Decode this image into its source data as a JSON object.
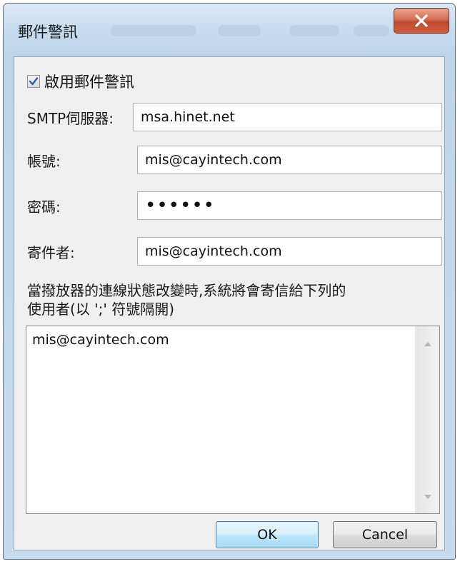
{
  "window": {
    "title": "郵件警訊"
  },
  "form": {
    "enable_label": "啟用郵件警訊",
    "enable_checked": true,
    "smtp_label": "SMTP伺服器:",
    "smtp_value": "msa.hinet.net",
    "account_label": "帳號:",
    "account_value": "mis@cayintech.com",
    "password_label": "密碼:",
    "password_value": "••••••",
    "sender_label": "寄件者:",
    "sender_value": "mis@cayintech.com",
    "recipients_desc_line1": "當撥放器的連線狀態改變時,系統將會寄信給下列的",
    "recipients_desc_line2": "使用者(以 ';' 符號隔開)",
    "recipients_value": "mis@cayintech.com"
  },
  "buttons": {
    "ok_label": "OK",
    "cancel_label": "Cancel"
  },
  "icons": {
    "close": "close-icon",
    "checkbox": "checkmark-icon"
  },
  "colors": {
    "close_button": "#c95f43",
    "ok_button_border": "#3c7fb1",
    "title_bar": "#c6dbee"
  }
}
